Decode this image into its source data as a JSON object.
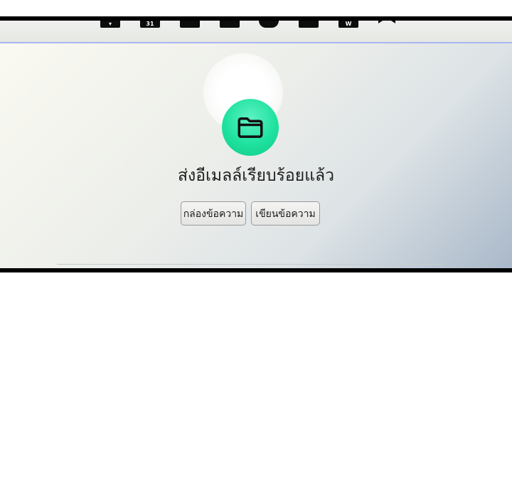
{
  "toolbar": {
    "icons": [
      {
        "name": "tool-icon-1",
        "glyph": "▾"
      },
      {
        "name": "calendar-icon",
        "glyph": "31"
      },
      {
        "name": "list-icon",
        "glyph": ""
      },
      {
        "name": "document-icon",
        "glyph": ""
      },
      {
        "name": "shield-icon",
        "glyph": ""
      },
      {
        "name": "grid-icon",
        "glyph": ""
      },
      {
        "name": "word-icon",
        "glyph": "W"
      }
    ],
    "bookmark_icon": "bookmark-icon"
  },
  "status": {
    "icon": "folder-icon",
    "icon_color": "#1fe29f",
    "message": "ส่งอีเมลล์เรียบร้อยแล้ว"
  },
  "actions": {
    "inbox_label": "กล่องข้อความ",
    "compose_label": "เขียนข้อความ"
  }
}
